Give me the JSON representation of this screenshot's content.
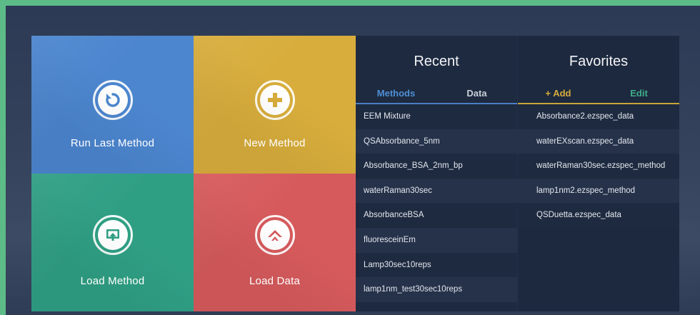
{
  "tiles": [
    {
      "label": "Run Last Method",
      "icon": "refresh-icon",
      "color": "#4c86cf"
    },
    {
      "label": "New Method",
      "icon": "plus-icon",
      "color": "#d8ad3c"
    },
    {
      "label": "Load Method",
      "icon": "load-method-icon",
      "color": "#2f9f84"
    },
    {
      "label": "Load Data",
      "icon": "load-data-icon",
      "color": "#d65a5c"
    }
  ],
  "recent": {
    "title": "Recent",
    "tabs": {
      "methods": "Methods",
      "data": "Data"
    },
    "items": [
      "EEM Mixture",
      "QSAbsorbance_5nm",
      "Absorbance_BSA_2nm_bp",
      "waterRaman30sec",
      "AbsorbanceBSA",
      "fluoresceinEm",
      "Lamp30sec10reps",
      "lamp1nm_test30sec10reps"
    ]
  },
  "favorites": {
    "title": "Favorites",
    "tabs": {
      "add": "+ Add",
      "edit": "Edit"
    },
    "items": [
      "Absorbance2.ezspec_data",
      "waterEXscan.ezspec_data",
      "waterRaman30sec.ezspec_method",
      "lamp1nm2.ezspec_method",
      "QSDuetta.ezspec_data"
    ]
  }
}
